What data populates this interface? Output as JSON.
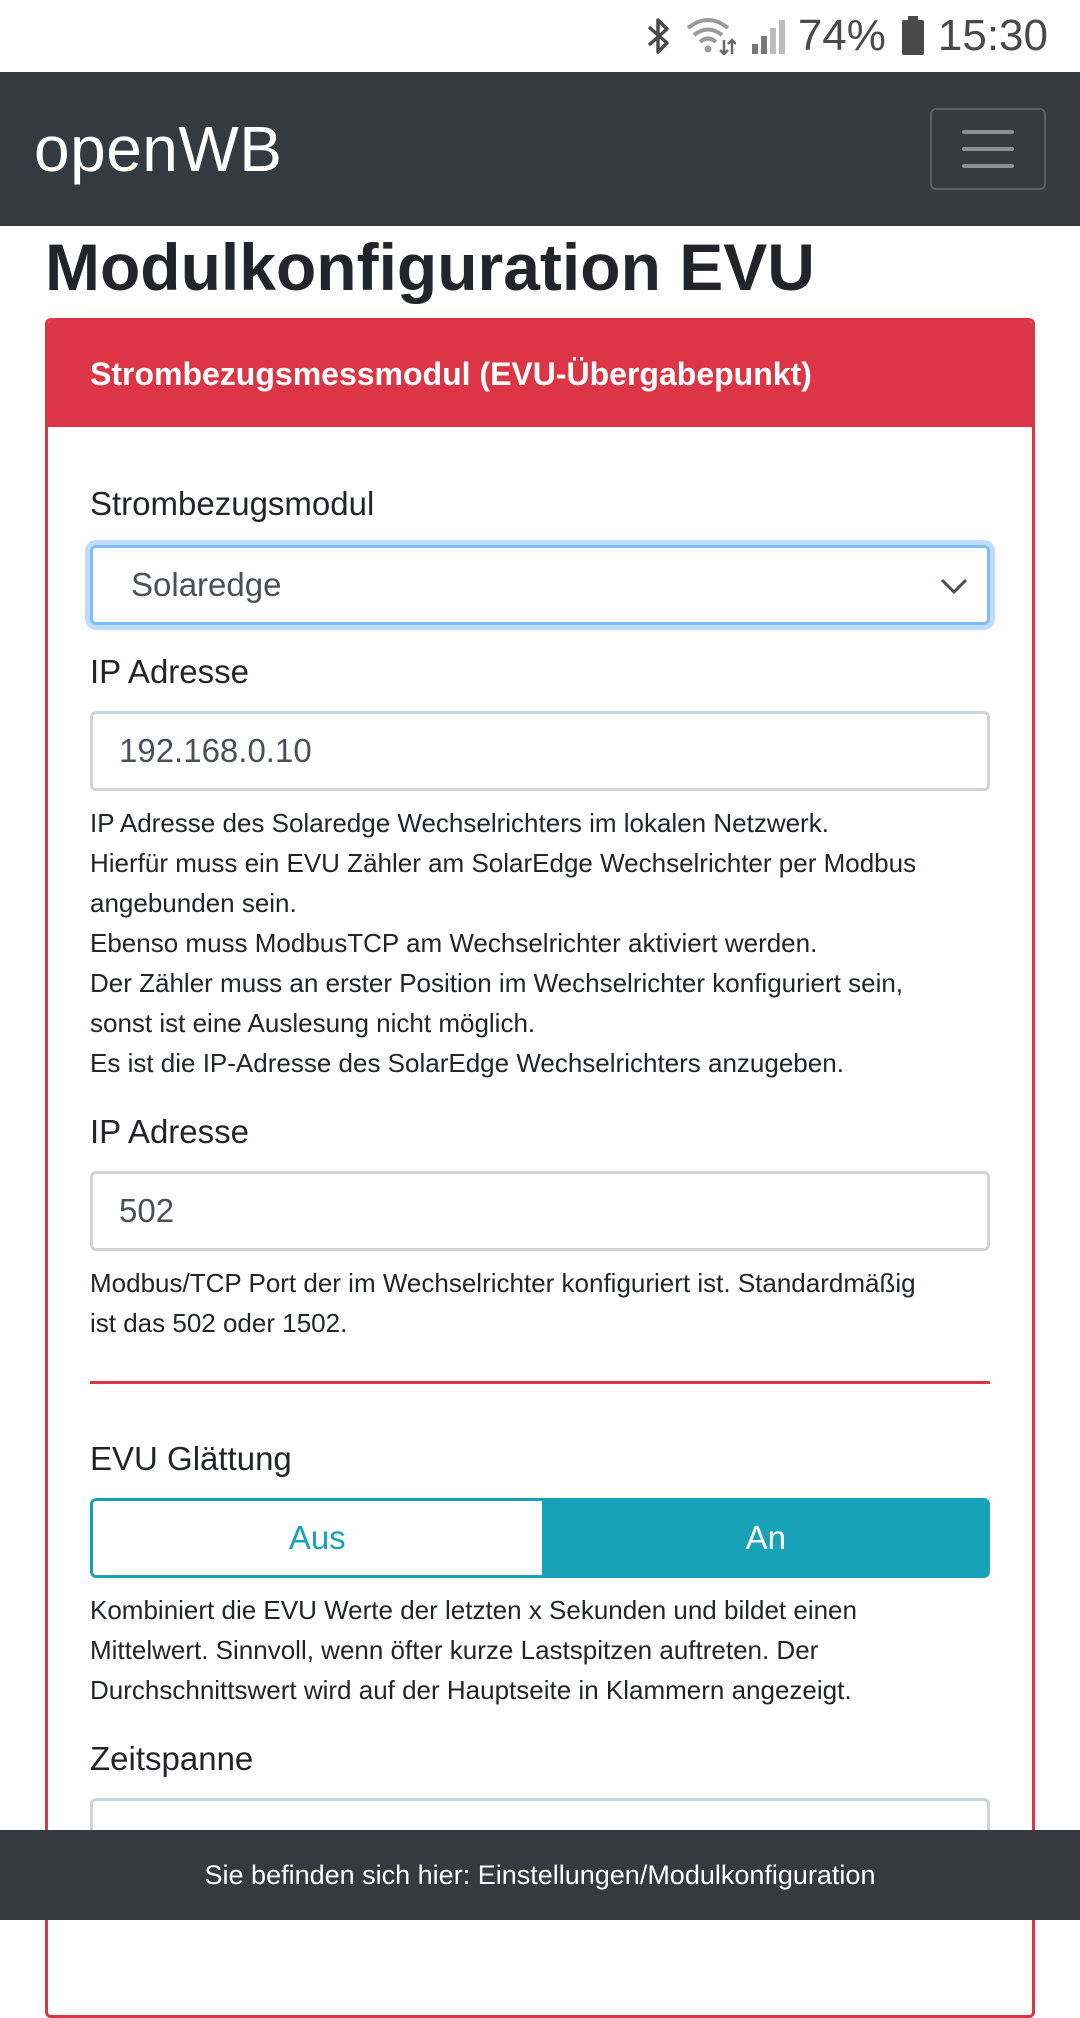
{
  "status_bar": {
    "icons": [
      "bluetooth-icon",
      "wifi-icon",
      "signal-icon",
      "battery-icon"
    ],
    "battery": "74%",
    "time": "15:30"
  },
  "navbar": {
    "brand": "openWB",
    "menu_icon": "hamburger-icon"
  },
  "page": {
    "title": "Modulkonfiguration EVU"
  },
  "card": {
    "header": "Strombezugsmessmodul (EVU-Übergabepunkt)",
    "module_label": "Strombezugsmodul",
    "module_value": "Solaredge",
    "ip_label": "IP Adresse",
    "ip_value": "192.168.0.10",
    "ip_help": [
      "IP Adresse des Solaredge Wechselrichters im lokalen Netzwerk.",
      "Hierfür muss ein EVU Zähler am SolarEdge Wechselrichter per Modbus",
      "angebunden sein.",
      "Ebenso muss ModbusTCP am Wechselrichter aktiviert werden.",
      "Der Zähler muss an erster Position im Wechselrichter konfiguriert sein,",
      "sonst ist eine Auslesung nicht möglich.",
      "Es ist die IP-Adresse des SolarEdge Wechselrichters anzugeben."
    ],
    "port_label": "IP Adresse",
    "port_value": "502",
    "port_help": [
      "Modbus/TCP Port der im Wechselrichter konfiguriert ist. Standardmäßig",
      "ist das 502 oder 1502."
    ],
    "smoothing_label": "EVU Glättung",
    "smoothing_off": "Aus",
    "smoothing_on": "An",
    "smoothing_selected": "An",
    "smoothing_help": [
      "Kombiniert die EVU Werte der letzten x Sekunden und bildet einen",
      "Mittelwert. Sinnvoll, wenn öfter kurze Lastspitzen auftreten. Der",
      "Durchschnittswert wird auf der Hauptseite in Klammern angezeigt."
    ],
    "timespan_label": "Zeitspanne"
  },
  "footer": {
    "text": "Sie befinden sich hier: Einstellungen/Modulkonfiguration"
  },
  "colors": {
    "navbar": "#343a40",
    "danger": "#dc3545",
    "info": "#17a2b8"
  }
}
